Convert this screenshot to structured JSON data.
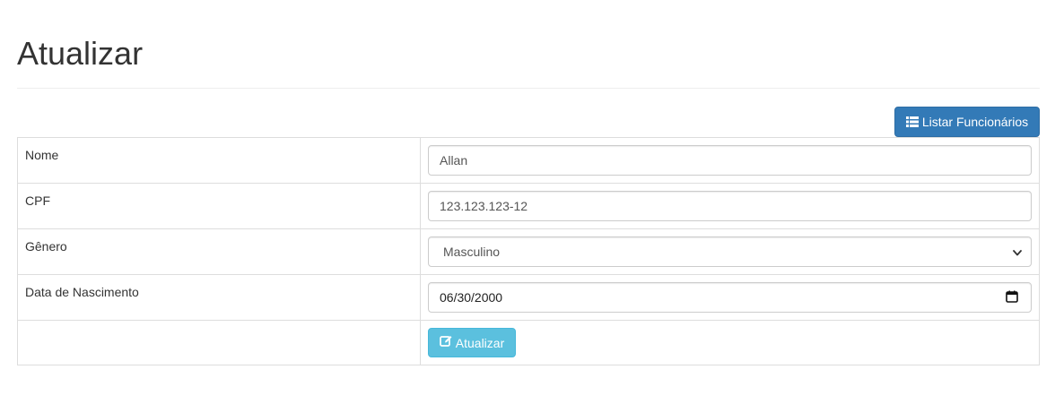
{
  "page": {
    "title": "Atualizar"
  },
  "toolbar": {
    "list_button_label": "Listar Funcionários",
    "list_button_icon": "list-icon",
    "list_button_color": "#337ab7"
  },
  "form": {
    "nome": {
      "label": "Nome",
      "value": "Allan"
    },
    "cpf": {
      "label": "CPF",
      "value": "123.123.123-12"
    },
    "genero": {
      "label": "Gênero",
      "selected": "Masculino"
    },
    "nascimento": {
      "label": "Data de Nascimento",
      "value": "06/30/2000",
      "icon": "calendar-icon"
    },
    "submit": {
      "label": "Atualizar",
      "icon": "edit-icon",
      "color": "#5bc0de"
    }
  }
}
